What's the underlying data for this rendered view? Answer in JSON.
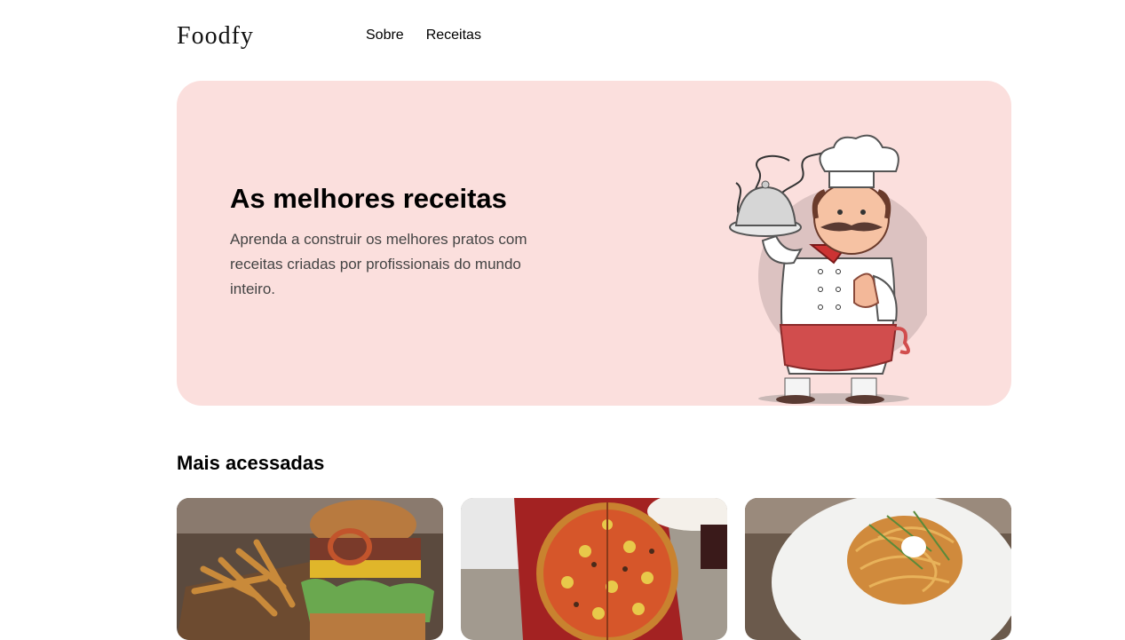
{
  "header": {
    "logo": "Foodfy",
    "nav": [
      {
        "label": "Sobre"
      },
      {
        "label": "Receitas"
      }
    ]
  },
  "hero": {
    "title": "As melhores receitas",
    "description": "Aprenda a construir os melhores pratos com receitas criadas por profissionais do mundo inteiro.",
    "illustration": "chef-illustration"
  },
  "most_accessed": {
    "title": "Mais acessadas",
    "cards": [
      {
        "image": "burger-with-fries-photo"
      },
      {
        "image": "pizza-photo"
      },
      {
        "image": "spaghetti-photo"
      }
    ]
  },
  "colors": {
    "hero_background": "#fbdfdd",
    "text_primary": "#000000",
    "text_secondary": "#444444"
  }
}
